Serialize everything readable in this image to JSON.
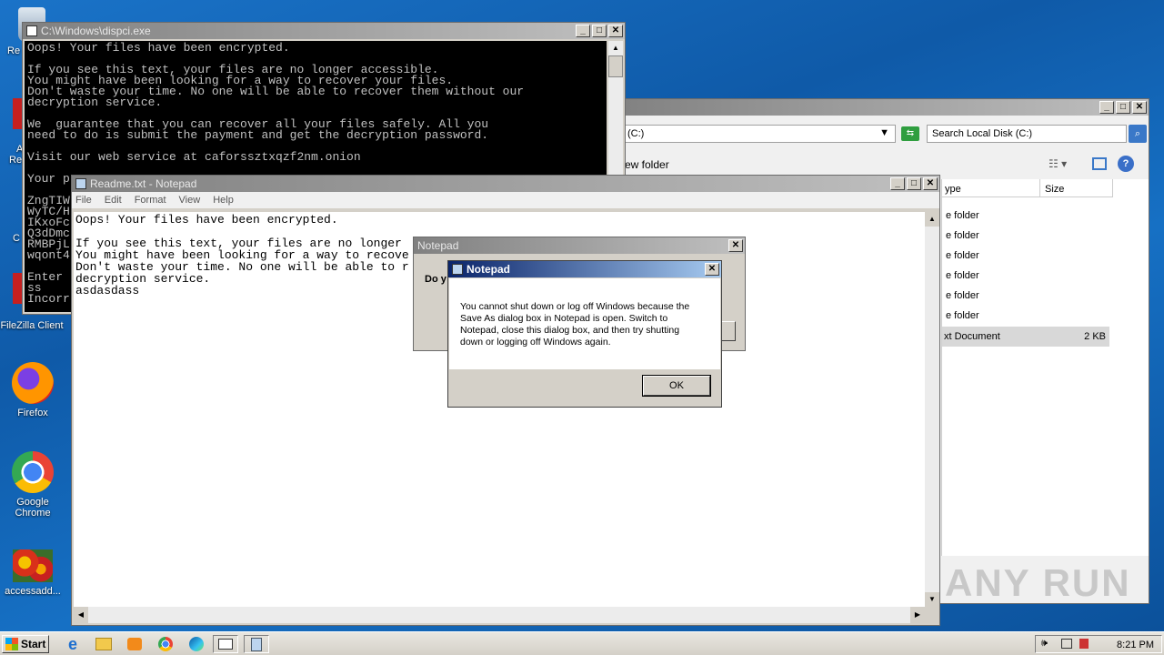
{
  "desktop": {
    "icons": [
      {
        "label": "Re",
        "icon": "recycle-bin-icon"
      },
      {
        "label": "FileZilla Client",
        "icon": "filezilla-icon"
      },
      {
        "label": "Firefox",
        "icon": "firefox-icon"
      },
      {
        "label": "Google Chrome",
        "icon": "chrome-icon"
      },
      {
        "label": "accessadd...",
        "icon": "flower-image-icon"
      }
    ],
    "partial_labels": [
      "A",
      "Re",
      "C"
    ]
  },
  "console_window": {
    "title": "C:\\Windows\\dispci.exe",
    "lines": [
      "Oops! Your files have been encrypted.",
      "",
      "If you see this text, your files are no longer accessible.",
      "You might have been looking for a way to recover your files.",
      "Don't waste your time. No one will be able to recover them without our",
      "decryption service.",
      "",
      "We  guarantee that you can recover all your files safely. All you",
      "need to do is submit the payment and get the decryption password.",
      "",
      "Visit our web service at caforssztxqzf2nm.onion",
      "",
      "Your p",
      "",
      "ZngTIW",
      "WyTC/H",
      "IKxoFc",
      "Q3dDmc",
      "RMBPjL",
      "wqont4",
      "",
      "Enter",
      "ss",
      "Incorr"
    ]
  },
  "explorer_window": {
    "address": "(C:)",
    "search_placeholder": "Search Local Disk (C:)",
    "toolbar_new_folder": "ew folder",
    "columns": [
      "ype",
      "Size"
    ],
    "rows": [
      {
        "type": "e folder",
        "size": ""
      },
      {
        "type": "e folder",
        "size": ""
      },
      {
        "type": "e folder",
        "size": ""
      },
      {
        "type": "e folder",
        "size": ""
      },
      {
        "type": "e folder",
        "size": ""
      },
      {
        "type": "e folder",
        "size": ""
      },
      {
        "type": "xt Document",
        "size": "2 KB"
      }
    ],
    "watermark": "ANY RUN"
  },
  "notepad_window": {
    "title": "Readme.txt - Notepad",
    "menu": [
      "File",
      "Edit",
      "Format",
      "View",
      "Help"
    ],
    "lines": [
      "Oops! Your files have been encrypted.",
      "",
      "If you see this text, your files are no longer",
      "You might have been looking for a way to recove",
      "Don't waste your time. No one will be able to r",
      "decryption service.",
      "asdasdass"
    ]
  },
  "notepad_bg_dialog": {
    "title": "Notepad",
    "text": "Do y"
  },
  "notepad_dialog": {
    "title": "Notepad",
    "message": "You cannot shut down or log off Windows because the Save As dialog box in Notepad is open. Switch to Notepad, close this dialog box, and then try shutting down or logging off Windows again.",
    "ok_label": "OK"
  },
  "taskbar": {
    "start_label": "Start",
    "clock": "8:21 PM"
  },
  "colors": {
    "desktop": "#1670c4",
    "active_title": "#0a246a",
    "console_bg": "#000000"
  }
}
